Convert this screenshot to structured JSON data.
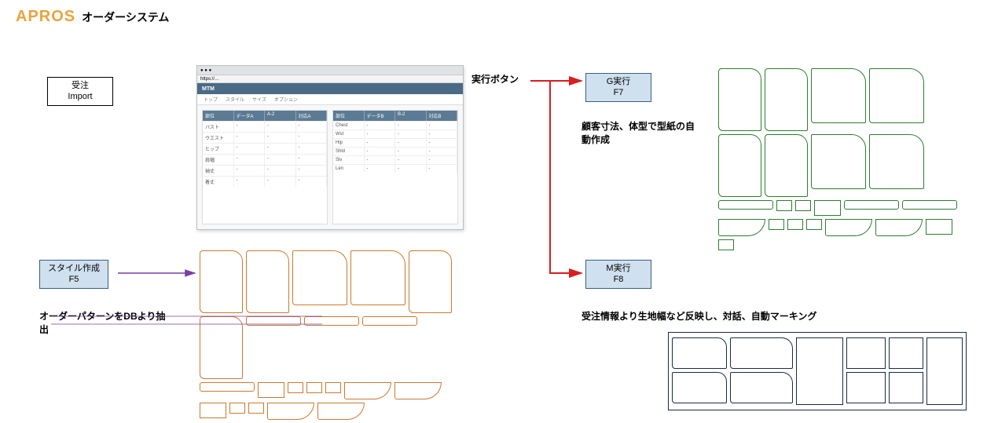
{
  "header": {
    "brand": "APROS",
    "subtitle": "オーダーシステム"
  },
  "buttons": {
    "import": {
      "line1": "受注",
      "line2": "Import"
    },
    "style": {
      "line1": "スタイル作成",
      "line2": "F5"
    },
    "g_exec": {
      "line1": "G実行",
      "line2": "F7"
    },
    "m_exec": {
      "line1": "M実行",
      "line2": "F8"
    }
  },
  "labels": {
    "exec_button": "実行ボタン",
    "g_desc": "顧客寸法、体型で型紙の自動作成",
    "db_desc": "オーダーパターンをDBより抽出",
    "m_desc": "受注情報より生地幅など反映し、対話、自動マーキング"
  },
  "browser": {
    "app": "MTM",
    "tabs": [
      "トップ",
      "スタイル",
      "サイズ",
      "オプション"
    ],
    "table_left": {
      "headers": [
        "部位",
        "データA",
        "A-2",
        "対応A"
      ],
      "rows": [
        [
          "バスト",
          "-",
          "-",
          "-"
        ],
        [
          "ウエスト",
          "-",
          "-",
          "-"
        ],
        [
          "ヒップ",
          "-",
          "-",
          "-"
        ],
        [
          "肩幅",
          "-",
          "-",
          "-"
        ],
        [
          "袖丈",
          "-",
          "-",
          "-"
        ],
        [
          "着丈",
          "-",
          "-",
          "-"
        ]
      ]
    },
    "table_right": {
      "headers": [
        "部位",
        "データB",
        "B-2",
        "対応B"
      ],
      "rows": [
        [
          "Chest",
          "-",
          "-",
          "-"
        ],
        [
          "Wst",
          "-",
          "-",
          "-"
        ],
        [
          "Hip",
          "-",
          "-",
          "-"
        ],
        [
          "Shld",
          "-",
          "-",
          "-"
        ],
        [
          "Slv",
          "-",
          "-",
          "-"
        ],
        [
          "Len",
          "-",
          "-",
          "-"
        ]
      ]
    }
  }
}
